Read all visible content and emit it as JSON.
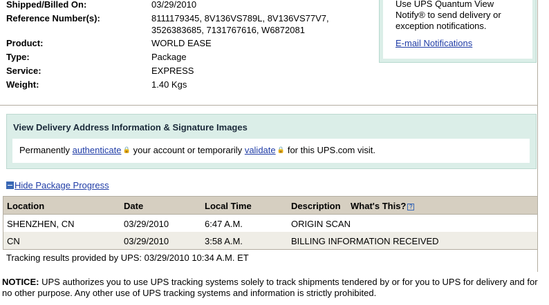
{
  "details": [
    {
      "label": "Shipped/Billed On:",
      "value": "03/29/2010"
    },
    {
      "label": "Reference Number(s):",
      "value": "8111179345, 8V136VS789L, 8V136VS77V7,",
      "value2": "3526383685, 7131767616, W6872081"
    },
    {
      "label": "Product:",
      "value": "WORLD EASE"
    },
    {
      "label": "Type:",
      "value": "Package"
    },
    {
      "label": "Service:",
      "value": "EXPRESS"
    },
    {
      "label": "Weight:",
      "value": "1.40 Kgs"
    }
  ],
  "notify": {
    "line1": "Use UPS Quantum View",
    "line2": "Notify® to send delivery or",
    "line3": "exception notifications.",
    "link": "E-mail Notifications"
  },
  "address": {
    "title": "View Delivery Address Information & Signature Images",
    "text_before": "Permanently",
    "authenticate": "authenticate",
    "text_middle": "your account or temporarily",
    "validate": "validate",
    "text_after": "for this UPS.com visit."
  },
  "progress": {
    "toggle_label": "Hide Package Progress",
    "headers": {
      "location": "Location",
      "date": "Date",
      "time": "Local Time",
      "description": "Description",
      "whats_this": "What's This?"
    },
    "rows": [
      {
        "location": "SHENZHEN, CN",
        "date": "03/29/2010",
        "time": "6:47 A.M.",
        "description": "ORIGIN SCAN"
      },
      {
        "location": "CN",
        "date": "03/29/2010",
        "time": "3:58 A.M.",
        "description": "BILLING INFORMATION RECEIVED"
      }
    ],
    "provided_by": "Tracking results provided by UPS:  03/29/2010 10:34 A.M.  ET"
  },
  "notice": {
    "label": "NOTICE:",
    "text": " UPS authorizes you to use UPS tracking systems solely to track shipments tendered by or for you to UPS for delivery and for no other purpose. Any other use of UPS tracking systems and information is strictly prohibited."
  },
  "colors": {
    "link": "#1f3ca6",
    "table_header_bg": "#d6cfc1",
    "address_box_bg": "#dbeee8"
  }
}
